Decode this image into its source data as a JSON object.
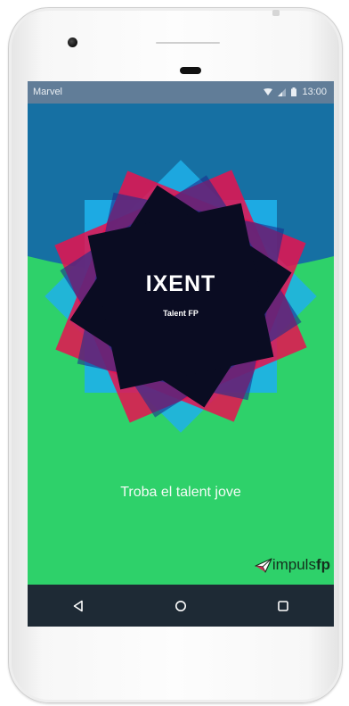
{
  "status_bar": {
    "carrier": "Marvel",
    "time": "13:00"
  },
  "splash": {
    "title": "IXENT",
    "subtitle": "Talent FP",
    "tagline": "Troba el talent jove"
  },
  "brand": {
    "prefix": "impuls",
    "suffix": "fp"
  },
  "colors": {
    "top_blue": "#1670a3",
    "bottom_green": "#2ed16a",
    "magenta": "#e8114f",
    "cyan": "#1eb0ea",
    "navy": "#0a0c22",
    "nav_bar": "#1e2a35"
  },
  "icons": {
    "status": [
      "wifi-icon",
      "signal-icon",
      "battery-icon"
    ],
    "nav": [
      "back-icon",
      "home-icon",
      "recents-icon"
    ]
  }
}
